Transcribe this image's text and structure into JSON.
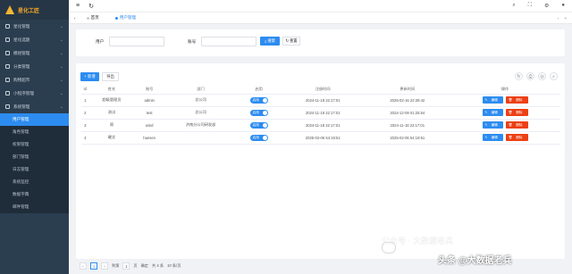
{
  "app": {
    "title": "星化工匠"
  },
  "sidebar": {
    "items": [
      {
        "label": "星化管理"
      },
      {
        "label": "星化选题"
      },
      {
        "label": "模组管理"
      },
      {
        "label": "分类管理"
      },
      {
        "label": "购物超市"
      },
      {
        "label": "小程序管理"
      },
      {
        "label": "系统管理"
      }
    ],
    "subitems": [
      {
        "label": "用户管理",
        "active": true
      },
      {
        "label": "角色管理"
      },
      {
        "label": "权限管理"
      },
      {
        "label": "部门管理"
      },
      {
        "label": "日志管理"
      },
      {
        "label": "系统监控"
      },
      {
        "label": "数据字典"
      },
      {
        "label": "邮件管理"
      }
    ]
  },
  "tabs": [
    {
      "label": "首页"
    },
    {
      "label": "用户管理",
      "active": true
    }
  ],
  "search": {
    "user_label": "用户",
    "account_label": "账号",
    "search_btn": "搜索",
    "reset_btn": "重置"
  },
  "toolbar": {
    "add": "+ 新增",
    "import": "导出"
  },
  "table": {
    "headers": [
      "Id",
      "姓名",
      "账号",
      "部门",
      "启用",
      "注册时间",
      "更新时间",
      "操作"
    ],
    "rows": [
      [
        "1",
        "超级管理员",
        "admin",
        "总公司",
        "启用",
        "2024-11-18 22:17:01",
        "2025-02-16 22:39:42"
      ],
      [
        "2",
        "测试",
        "test",
        "总公司",
        "启用",
        "2024-11-18 22:17:01",
        "2024-12-09 01:25:54"
      ],
      [
        "3",
        "周",
        "wind",
        "济南分公司研发部",
        "启用",
        "2024-11-18 22:17:01",
        "2024-11-18 22:17:01"
      ],
      [
        "4",
        "硬文",
        "hansen",
        "",
        "启用",
        "2025-02-06 54:19:51",
        "2025-02-06 54:19:51"
      ]
    ],
    "edit_label": "编辑",
    "delete_label": "删除"
  },
  "pager": {
    "current": "1",
    "goto_label": "到第",
    "page_input": "1",
    "page_unit": "页",
    "confirm": "确定",
    "total": "共 4 条",
    "page_size": "10 条/页"
  },
  "watermark": {
    "line1": "公众号 · 大数据老兵",
    "line2": "头条 @大数据老兵"
  }
}
